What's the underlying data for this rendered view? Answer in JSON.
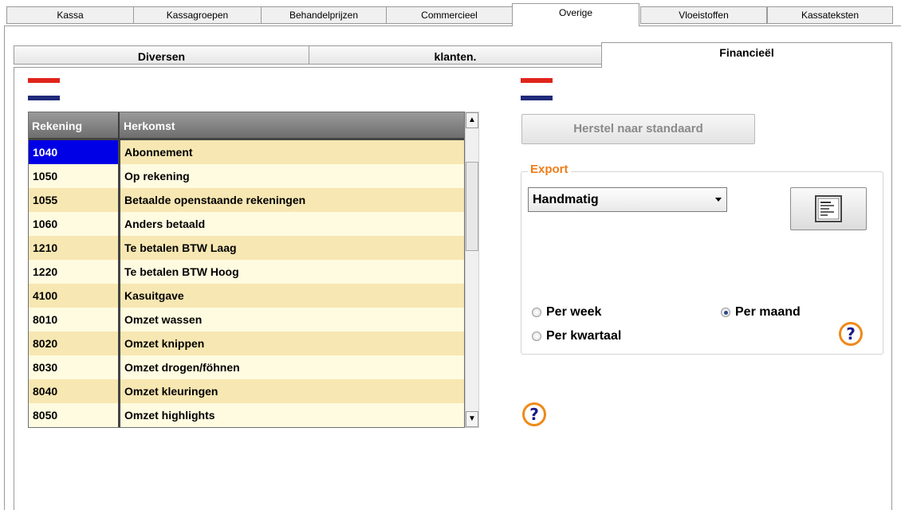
{
  "top_tabs": [
    "Kassa",
    "Kassagroepen",
    "Behandelprijzen",
    "Commercieel",
    "Overige",
    "Vloeistoffen",
    "Kassateksten"
  ],
  "top_tab_active": "Overige",
  "sub_tabs": [
    "Diversen",
    "klanten.",
    "Financieël"
  ],
  "sub_tab_active": "Financieël",
  "table": {
    "columns": [
      "Rekening",
      "Herkomst"
    ],
    "rows": [
      {
        "rekening": "1040",
        "herkomst": "Abonnement",
        "selected": true
      },
      {
        "rekening": "1050",
        "herkomst": "Op rekening"
      },
      {
        "rekening": "1055",
        "herkomst": "Betaalde openstaande rekeningen"
      },
      {
        "rekening": "1060",
        "herkomst": "Anders betaald"
      },
      {
        "rekening": "1210",
        "herkomst": "Te betalen BTW Laag"
      },
      {
        "rekening": "1220",
        "herkomst": "Te betalen BTW Hoog"
      },
      {
        "rekening": "4100",
        "herkomst": "Kasuitgave"
      },
      {
        "rekening": "8010",
        "herkomst": "Omzet wassen"
      },
      {
        "rekening": "8020",
        "herkomst": "Omzet knippen"
      },
      {
        "rekening": "8030",
        "herkomst": "Omzet drogen/föhnen"
      },
      {
        "rekening": "8040",
        "herkomst": "Omzet kleuringen"
      },
      {
        "rekening": "8050",
        "herkomst": "Omzet highlights"
      }
    ]
  },
  "restore_button": "Herstel naar standaard",
  "export": {
    "legend": "Export",
    "select_value": "Handmatig",
    "radios": [
      {
        "label": "Per week",
        "checked": false
      },
      {
        "label": "Per maand",
        "checked": true
      },
      {
        "label": "Per kwartaal",
        "checked": false
      }
    ]
  },
  "help_glyph": "?",
  "colors": {
    "flag_red": "#e0241b",
    "flag_blue": "#1f2a7a",
    "selected_cell": "#0000e6",
    "row_odd": "#f7e7b2",
    "row_even": "#fffbe0",
    "accent_orange": "#ee7d1a"
  }
}
